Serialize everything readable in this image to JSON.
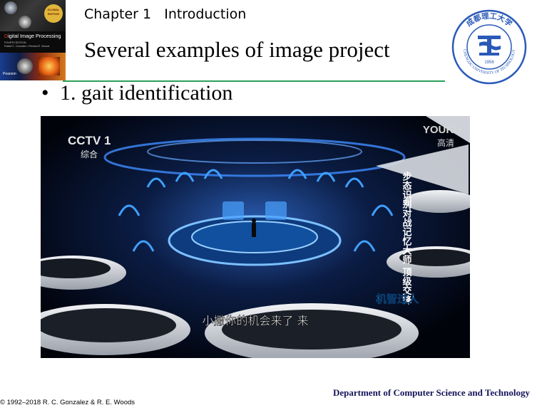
{
  "header": {
    "chapter": "Chapter 1   Introduction",
    "title": "Several examples of image project"
  },
  "book_cover": {
    "badge": "GLOBAL EDITION",
    "title_first_letter": "D",
    "title_rest": "igital Image Processing",
    "edition": "FOURTH EDITION",
    "authors": "Rafael C. Gonzalez • Richard E. Woods",
    "publisher": "Pearson"
  },
  "bullet": {
    "marker": "•",
    "text": "1. gait identification"
  },
  "video_frame": {
    "channel_logo": "CCTV 1",
    "channel_name": "综合",
    "platform": "YOUKU",
    "quality": "高清",
    "vertical_caption": "步态识别对战记忆大师 顶级交锋",
    "show_logo": "机智过人",
    "subtitle": "小撒你的机会来了 来"
  },
  "logo": {
    "year": "1956",
    "english": "CHENGDU UNIVERSITY OF TECHNOLOGY",
    "chinese": "成都理工大学"
  },
  "footer": {
    "department": "Department of Computer Science and Technology",
    "copyright": "© 1992–2018  R. C. Gonzalez & R. E. Woods"
  },
  "colors": {
    "rule": "#2aa05a",
    "logo_blue": "#2a5ab8",
    "department_text": "#14145a"
  }
}
